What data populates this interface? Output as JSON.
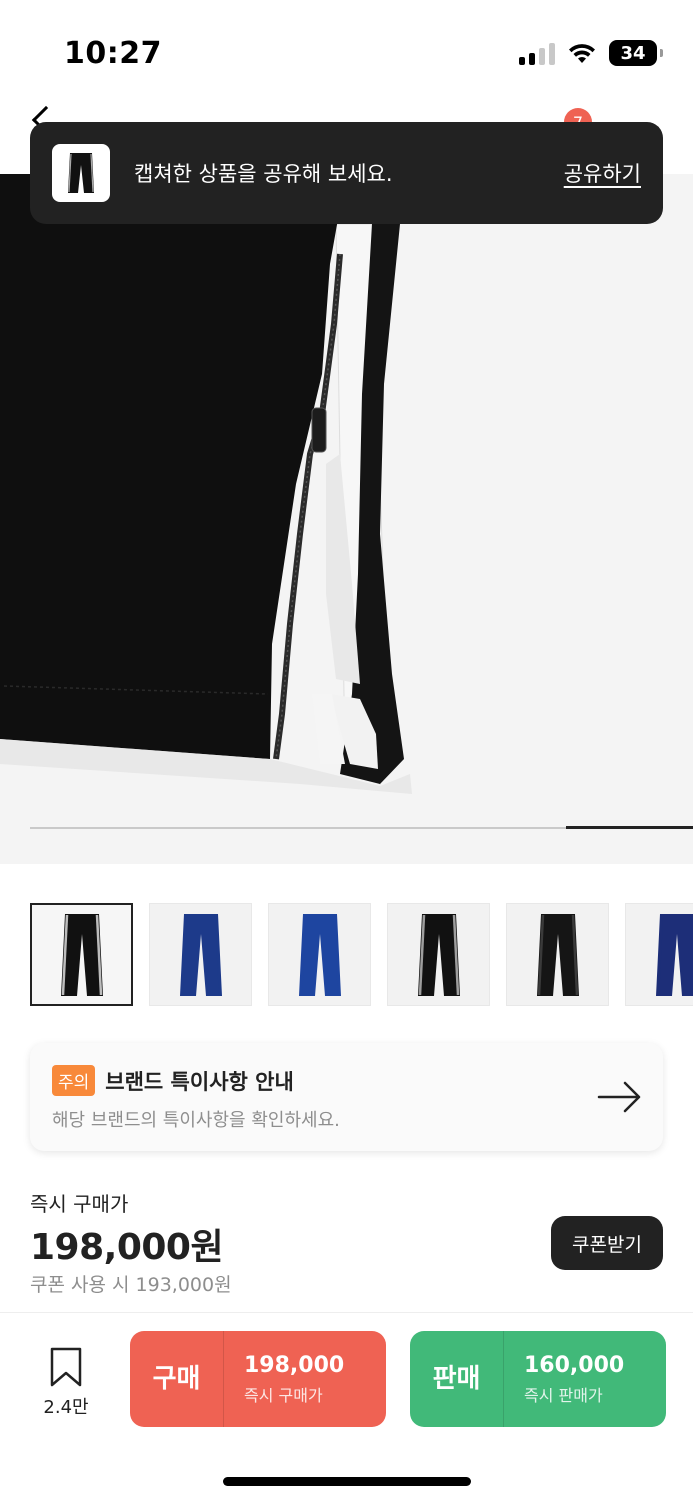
{
  "status_bar": {
    "time": "10:27",
    "battery": "34",
    "icons": [
      "signal-icon",
      "wifi-icon",
      "battery-icon"
    ]
  },
  "header": {
    "cart_count": "7"
  },
  "toast": {
    "message": "캡쳐한 상품을 공유해 보세요.",
    "action": "공유하기"
  },
  "thumbnails": {
    "items": [
      {
        "color": "#111111",
        "stripe": "#bdbdbd"
      },
      {
        "color": "#1d3a8a",
        "stripe": "#1d3a8a"
      },
      {
        "color": "#1e45a0",
        "stripe": "#1e45a0"
      },
      {
        "color": "#111111",
        "stripe": "#9e9e9e"
      },
      {
        "color": "#151515",
        "stripe": "#3a3a3a"
      },
      {
        "color": "#1d2e78",
        "stripe": "#1d2e78"
      }
    ]
  },
  "notice": {
    "badge": "주의",
    "title": "브랜드 특이사항 안내",
    "subtitle": "해당 브랜드의 특이사항을 확인하세요."
  },
  "price": {
    "label": "즉시 구매가",
    "value": "198,000원",
    "coupon_text": "쿠폰 사용 시 193,000원",
    "coupon_button": "쿠폰받기"
  },
  "bottom_bar": {
    "bookmark_count": "2.4만",
    "buy": {
      "kind": "구매",
      "amount": "198,000",
      "caption": "즉시 구매가"
    },
    "sell": {
      "kind": "판매",
      "amount": "160,000",
      "caption": "즉시 판매가"
    }
  },
  "colors": {
    "buy": "#ef6253",
    "sell": "#41b979",
    "notice_badge": "#f8893a"
  }
}
